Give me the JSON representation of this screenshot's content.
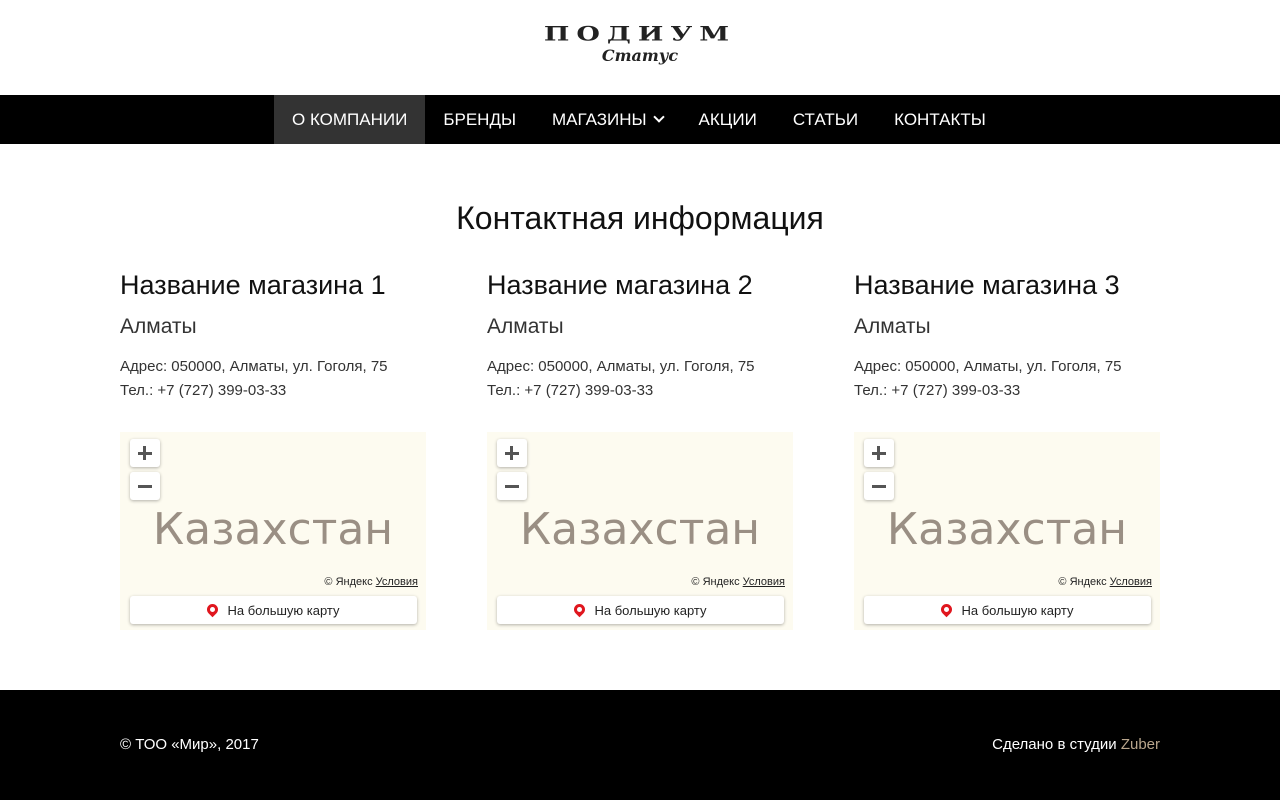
{
  "logo": {
    "main": "ПОДИУМ",
    "sub": "Статус"
  },
  "nav": {
    "items": [
      {
        "label": "О КОМПАНИИ",
        "active": true
      },
      {
        "label": "БРЕНДЫ"
      },
      {
        "label": "МАГАЗИНЫ",
        "has_dropdown": true,
        "dropdown_icon": "chevron-down-icon"
      },
      {
        "label": "АКЦИИ"
      },
      {
        "label": "СТАТЬИ"
      },
      {
        "label": "КОНТАКТЫ"
      }
    ]
  },
  "page": {
    "title": "Контактная информация"
  },
  "stores": [
    {
      "name": "Название магазина 1",
      "city": "Алматы",
      "address": "Адрес: 050000, Алматы, ул. Гоголя, 75",
      "phone": "Тел.: +7 (727) 399-03-33",
      "map": {
        "country": "Казахстан",
        "zoom_in": "+",
        "zoom_out": "−",
        "attribution": "© Яндекс",
        "terms": "Условия",
        "big_map": "На большую карту"
      }
    },
    {
      "name": "Название магазина 2",
      "city": "Алматы",
      "address": "Адрес: 050000, Алматы, ул. Гоголя, 75",
      "phone": "Тел.: +7 (727) 399-03-33",
      "map": {
        "country": "Казахстан",
        "zoom_in": "+",
        "zoom_out": "−",
        "attribution": "© Яндекс",
        "terms": "Условия",
        "big_map": "На большую карту"
      }
    },
    {
      "name": "Название магазина 3",
      "city": "Алматы",
      "address": "Адрес: 050000, Алматы, ул. Гоголя, 75",
      "phone": "Тел.: +7 (727) 399-03-33",
      "map": {
        "country": "Казахстан",
        "zoom_in": "+",
        "zoom_out": "−",
        "attribution": "© Яндекс",
        "terms": "Условия",
        "big_map": "На большую карту"
      }
    }
  ],
  "footer": {
    "copyright": "© ТОО «Мир», 2017",
    "studio_text": "Сделано в студии",
    "studio_link": "Zuber"
  },
  "colors": {
    "nav_bg": "#000000",
    "nav_active": "#333333",
    "footer_bg": "#000000",
    "accent_link": "#b9a68d",
    "map_pin": "#e0161e",
    "map_bg": "#fdfbf0"
  }
}
